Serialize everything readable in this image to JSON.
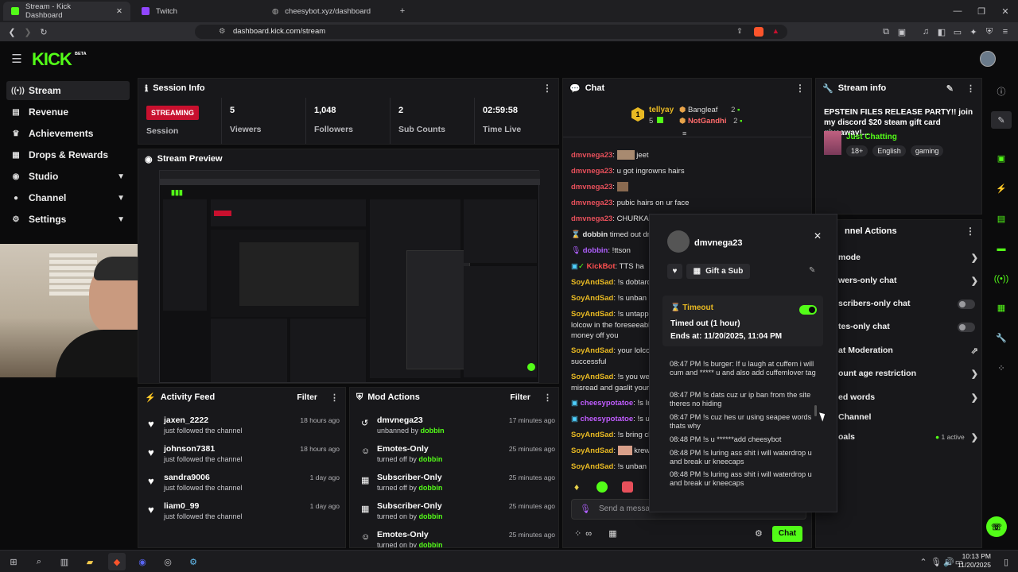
{
  "browser": {
    "tabs": [
      {
        "title": "Stream - Kick Dashboard"
      },
      {
        "title": "Twitch"
      },
      {
        "title": "cheesybot.xyz/dashboard"
      }
    ],
    "url": "dashboard.kick.com/stream"
  },
  "brand": {
    "logo": "KICK",
    "beta": "BETA",
    "accent": "#53fc18"
  },
  "sidebar": {
    "items": [
      {
        "label": "Stream",
        "icon": "stream-icon"
      },
      {
        "label": "Revenue",
        "icon": "revenue-icon"
      },
      {
        "label": "Achievements",
        "icon": "trophy-icon"
      },
      {
        "label": "Drops & Rewards",
        "icon": "gift-icon"
      },
      {
        "label": "Studio",
        "icon": "studio-icon"
      },
      {
        "label": "Channel",
        "icon": "channel-icon"
      },
      {
        "label": "Settings",
        "icon": "gear-icon"
      }
    ]
  },
  "session": {
    "title": "Session Info",
    "status": "STREAMING",
    "status_label": "Session",
    "stats": [
      {
        "value": "5",
        "label": "Viewers"
      },
      {
        "value": "1,048",
        "label": "Followers"
      },
      {
        "value": "2",
        "label": "Sub Counts"
      },
      {
        "value": "02:59:58",
        "label": "Time Live"
      }
    ]
  },
  "preview": {
    "title": "Stream Preview"
  },
  "activity": {
    "title": "Activity Feed",
    "filter": "Filter",
    "items": [
      {
        "name": "jaxen_2222",
        "sub": "just followed the channel",
        "time": "18 hours ago"
      },
      {
        "name": "johnson7381",
        "sub": "just followed the channel",
        "time": "18 hours ago"
      },
      {
        "name": "sandra9006",
        "sub": "just followed the channel",
        "time": "1 day ago"
      },
      {
        "name": "liam0_99",
        "sub": "just followed the channel",
        "time": "1 day ago"
      }
    ]
  },
  "mod_actions": {
    "title": "Mod Actions",
    "filter": "Filter",
    "items": [
      {
        "name": "dmvnega23",
        "action": "unbanned by",
        "by": "dobbin",
        "time": "17 minutes ago"
      },
      {
        "name": "Emotes-Only",
        "action": "turned off by",
        "by": "dobbin",
        "time": "25 minutes ago"
      },
      {
        "name": "Subscriber-Only",
        "action": "turned off by",
        "by": "dobbin",
        "time": "25 minutes ago"
      },
      {
        "name": "Subscriber-Only",
        "action": "turned on by",
        "by": "dobbin",
        "time": "25 minutes ago"
      },
      {
        "name": "Emotes-Only",
        "action": "turned on by",
        "by": "dobbin",
        "time": "25 minutes ago"
      }
    ]
  },
  "chat": {
    "title": "Chat",
    "leader": {
      "rank": "1",
      "name": "tellyay",
      "count": "5"
    },
    "top": [
      {
        "name": "Bangleaf",
        "count": "2"
      },
      {
        "name": "NotGandhi",
        "count": "2"
      }
    ],
    "lines": [
      {
        "user": "dmvnega23",
        "text": "jeet"
      },
      {
        "user": "dmvnega23",
        "text": "u got ingrowns hairs"
      },
      {
        "user": "dmvnega23",
        "text": ""
      },
      {
        "user": "dmvnega23",
        "text": "pubic hairs on ur face"
      },
      {
        "user": "dmvnega23",
        "text": "CHURKA"
      },
      {
        "user": "dobbin",
        "text": "timed out dmv"
      },
      {
        "user": "dobbin",
        "text": "!ttson"
      },
      {
        "user": "KickBot",
        "text": "TTS ha"
      },
      {
        "user": "SoyAndSad",
        "text": "!s dobtard"
      },
      {
        "user": "SoyAndSad",
        "text": "!s unban d"
      },
      {
        "user": "SoyAndSad",
        "text": "!s untappe"
      },
      {
        "user": "",
        "text": "lolcow in the foreseeabl"
      },
      {
        "user": "",
        "text": "money off you"
      },
      {
        "user": "SoyAndSad",
        "text": "your lolcow"
      },
      {
        "user": "",
        "text": "successful"
      },
      {
        "user": "SoyAndSad",
        "text": "!s you were"
      },
      {
        "user": "",
        "text": "misread and gaslit yours"
      },
      {
        "user": "cheesypotatoe",
        "text": "!s In"
      },
      {
        "user": "cheesypotatoe",
        "text": "!s unt"
      },
      {
        "user": "SoyAndSad",
        "text": "!s bring ch"
      },
      {
        "user": "SoyAndSad",
        "text": "krew"
      },
      {
        "user": "SoyAndSad",
        "text": "!s unban d"
      }
    ],
    "input_placeholder": "Send a message",
    "send": "Chat"
  },
  "user_card": {
    "name": "dmvnega23",
    "gift": "Gift a Sub",
    "timeout_title": "Timeout",
    "timeout_status": "Timed out (1 hour)",
    "timeout_ends": "Ends at: 11/20/2025, 11:04 PM",
    "messages": [
      {
        "time": "08:47 PM",
        "text": "!s burger: If u laugh at cuffem i will cum and ***** u and also add cuffemlover tag"
      },
      {
        "time": "08:47 PM",
        "text": "!s dats cuz ur ip ban from the site theres no hiding"
      },
      {
        "time": "08:47 PM",
        "text": "!s cuz hes ur using seapee words thats why"
      },
      {
        "time": "08:48 PM",
        "text": "!s u ******add cheesybot"
      },
      {
        "time": "08:48 PM",
        "text": "!s luring ass shit i will waterdrop u and break ur kneecaps"
      },
      {
        "time": "08:48 PM",
        "text": "!s luring ass shit i will waterdrop u and break ur kneecaps"
      }
    ]
  },
  "stream_info": {
    "title": "Stream info",
    "stream_title": "EPSTEIN FILES RELEASE PARTY!! join my discord $20 steam gift card giveaway!...",
    "category": "Just Chatting",
    "tags": [
      "18+",
      "English",
      "gaming"
    ]
  },
  "channel_actions": {
    "title": "nnel Actions",
    "items": [
      {
        "label": "mode",
        "kind": "arrow"
      },
      {
        "label": "wers-only chat",
        "kind": "arrow"
      },
      {
        "label": "scribers-only chat",
        "kind": "toggle"
      },
      {
        "label": "tes-only chat",
        "kind": "toggle"
      },
      {
        "label": "at Moderation",
        "kind": "external"
      },
      {
        "label": "ount age restriction",
        "kind": "arrow"
      },
      {
        "label": "ed words",
        "kind": "arrow"
      },
      {
        "label": "Channel",
        "kind": "none"
      },
      {
        "label": "oals",
        "kind": "arrow",
        "extra": "1 active"
      }
    ]
  },
  "taskbar": {
    "time": "10:13 PM",
    "date": "11/20/2025"
  }
}
